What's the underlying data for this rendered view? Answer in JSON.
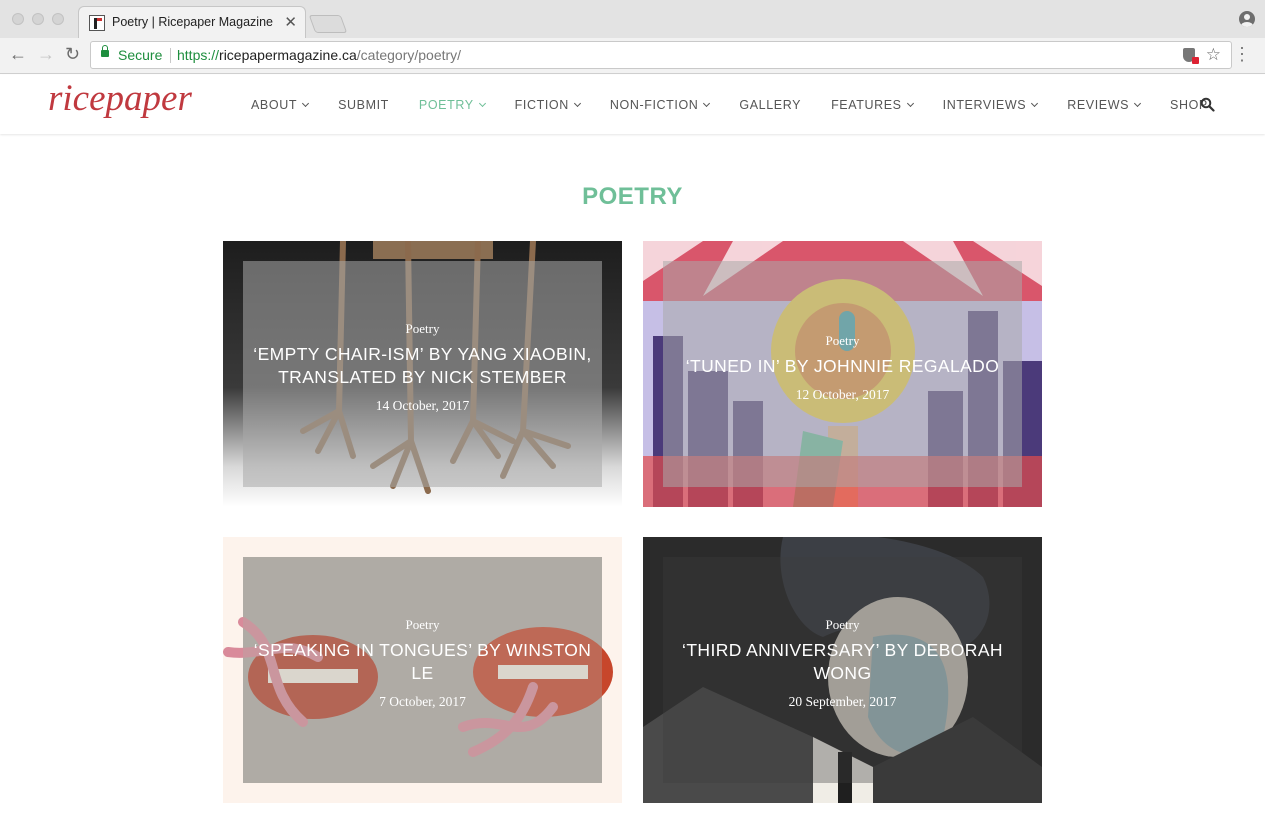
{
  "browser": {
    "tab_title": "Poetry | Ricepaper Magazine",
    "secure_label": "Secure",
    "url_protocol": "https://",
    "url_host": "ricepapermagazine.ca",
    "url_path": "/category/poetry/"
  },
  "site": {
    "logo_text": "ricepaper",
    "logo_color": "#c0393f",
    "accent_color": "#6fbf98",
    "nav": [
      {
        "label": "ABOUT",
        "has_dropdown": true
      },
      {
        "label": "SUBMIT",
        "has_dropdown": false
      },
      {
        "label": "POETRY",
        "has_dropdown": true,
        "active": true
      },
      {
        "label": "FICTION",
        "has_dropdown": true
      },
      {
        "label": "NON-FICTION",
        "has_dropdown": true
      },
      {
        "label": "GALLERY",
        "has_dropdown": false
      },
      {
        "label": "FEATURES",
        "has_dropdown": true
      },
      {
        "label": "INTERVIEWS",
        "has_dropdown": true
      },
      {
        "label": "REVIEWS",
        "has_dropdown": true
      },
      {
        "label": "SHOP",
        "has_dropdown": false
      }
    ],
    "search_icon": "search-icon"
  },
  "page": {
    "title": "POETRY",
    "posts": [
      {
        "category": "Poetry",
        "title": "‘EMPTY CHAIR-ISM’ BY YANG XIAOBIN, TRANSLATED BY NICK STEMBER",
        "date": "14 October, 2017"
      },
      {
        "category": "Poetry",
        "title": "‘TUNED IN’ BY JOHNNIE REGALADO",
        "date": "12 October, 2017"
      },
      {
        "category": "Poetry",
        "title": "‘SPEAKING IN TONGUES’ BY WINSTON LE",
        "date": "7 October, 2017"
      },
      {
        "category": "Poetry",
        "title": "‘THIRD ANNIVERSARY’ BY DEBORAH WONG",
        "date": "20 September, 2017"
      }
    ]
  }
}
